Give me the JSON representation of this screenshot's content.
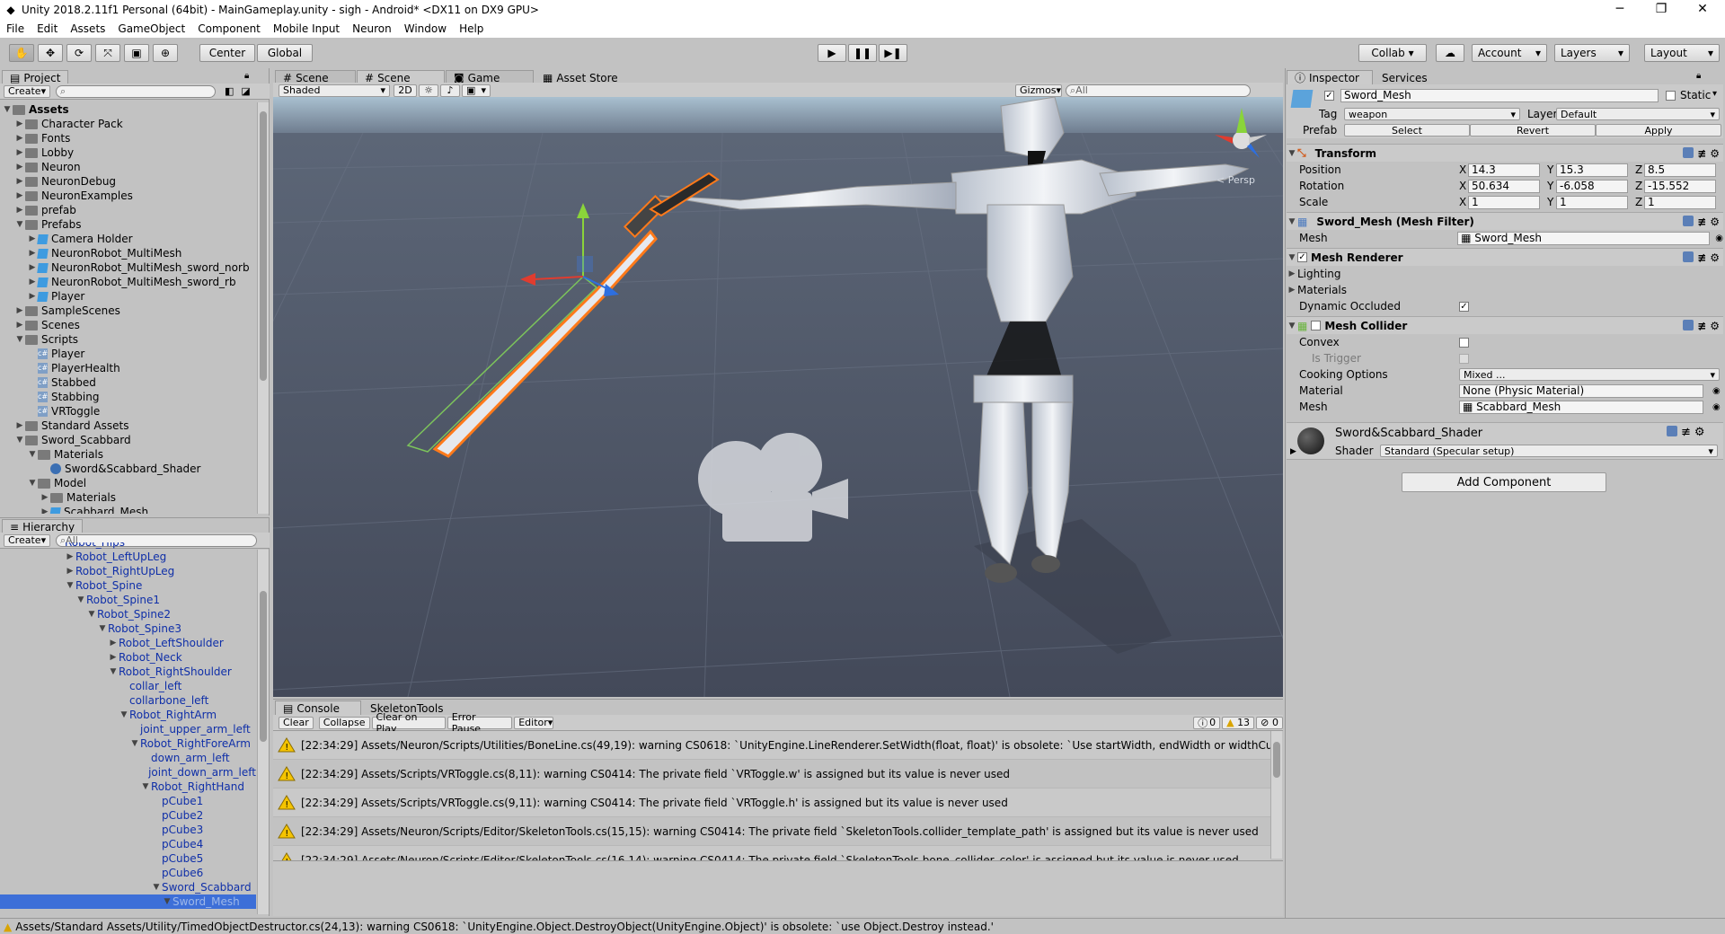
{
  "window": {
    "title": "Unity 2018.2.11f1 Personal (64bit) - MainGameplay.unity - sigh - Android* <DX11 on DX9 GPU>",
    "minimize": "─",
    "maximize": "❐",
    "close": "✕"
  },
  "menu": [
    "File",
    "Edit",
    "Assets",
    "GameObject",
    "Component",
    "Mobile Input",
    "Neuron",
    "Window",
    "Help"
  ],
  "toolbar": {
    "center": "Center",
    "global": "Global",
    "collab": "Collab ▾",
    "account": "Account",
    "layers": "Layers",
    "layout": "Layout"
  },
  "project": {
    "tab": "Project",
    "create": "Create",
    "items": [
      {
        "label": "Assets",
        "depth": 0,
        "open": true,
        "type": "folder",
        "bold": true
      },
      {
        "label": "Character Pack",
        "depth": 1,
        "type": "folder"
      },
      {
        "label": "Fonts",
        "depth": 1,
        "type": "folder"
      },
      {
        "label": "Lobby",
        "depth": 1,
        "type": "folder"
      },
      {
        "label": "Neuron",
        "depth": 1,
        "type": "folder"
      },
      {
        "label": "NeuronDebug",
        "depth": 1,
        "type": "folder"
      },
      {
        "label": "NeuronExamples",
        "depth": 1,
        "type": "folder"
      },
      {
        "label": "prefab",
        "depth": 1,
        "type": "folder"
      },
      {
        "label": "Prefabs",
        "depth": 1,
        "open": true,
        "type": "folder"
      },
      {
        "label": "Camera Holder",
        "depth": 2,
        "type": "prefab"
      },
      {
        "label": "NeuronRobot_MultiMesh",
        "depth": 2,
        "type": "prefab"
      },
      {
        "label": "NeuronRobot_MultiMesh_sword_norb",
        "depth": 2,
        "type": "prefab"
      },
      {
        "label": "NeuronRobot_MultiMesh_sword_rb",
        "depth": 2,
        "type": "prefab"
      },
      {
        "label": "Player",
        "depth": 2,
        "type": "prefab"
      },
      {
        "label": "SampleScenes",
        "depth": 1,
        "type": "folder"
      },
      {
        "label": "Scenes",
        "depth": 1,
        "type": "folder"
      },
      {
        "label": "Scripts",
        "depth": 1,
        "open": true,
        "type": "folder"
      },
      {
        "label": "Player",
        "depth": 2,
        "type": "script"
      },
      {
        "label": "PlayerHealth",
        "depth": 2,
        "type": "script"
      },
      {
        "label": "Stabbed",
        "depth": 2,
        "type": "script"
      },
      {
        "label": "Stabbing",
        "depth": 2,
        "type": "script"
      },
      {
        "label": "VRToggle",
        "depth": 2,
        "type": "script"
      },
      {
        "label": "Standard Assets",
        "depth": 1,
        "type": "folder"
      },
      {
        "label": "Sword_Scabbard",
        "depth": 1,
        "open": true,
        "type": "folder"
      },
      {
        "label": "Materials",
        "depth": 2,
        "open": true,
        "type": "folder"
      },
      {
        "label": "Sword&Scabbard_Shader",
        "depth": 3,
        "type": "material"
      },
      {
        "label": "Model",
        "depth": 2,
        "open": true,
        "type": "folder"
      },
      {
        "label": "Materials",
        "depth": 3,
        "type": "folder"
      },
      {
        "label": "Scabbard_Mesh",
        "depth": 3,
        "type": "prefab"
      }
    ]
  },
  "hierarchy": {
    "tab": "Hierarchy",
    "create": "Create",
    "search": "All",
    "items": [
      {
        "label": "Robot_Hips",
        "depth": 3,
        "arrow": ""
      },
      {
        "label": "Robot_LeftUpLeg",
        "depth": 4,
        "arrow": "▶"
      },
      {
        "label": "Robot_RightUpLeg",
        "depth": 4,
        "arrow": "▶"
      },
      {
        "label": "Robot_Spine",
        "depth": 4,
        "arrow": "▼"
      },
      {
        "label": "Robot_Spine1",
        "depth": 5,
        "arrow": "▼"
      },
      {
        "label": "Robot_Spine2",
        "depth": 6,
        "arrow": "▼"
      },
      {
        "label": "Robot_Spine3",
        "depth": 7,
        "arrow": "▼"
      },
      {
        "label": "Robot_LeftShoulder",
        "depth": 8,
        "arrow": "▶"
      },
      {
        "label": "Robot_Neck",
        "depth": 8,
        "arrow": "▶"
      },
      {
        "label": "Robot_RightShoulder",
        "depth": 8,
        "arrow": "▼"
      },
      {
        "label": "collar_left",
        "depth": 9,
        "arrow": ""
      },
      {
        "label": "collarbone_left",
        "depth": 9,
        "arrow": ""
      },
      {
        "label": "Robot_RightArm",
        "depth": 9,
        "arrow": "▼"
      },
      {
        "label": "joint_upper_arm_left",
        "depth": 10,
        "arrow": ""
      },
      {
        "label": "Robot_RightForeArm",
        "depth": 10,
        "arrow": "▼"
      },
      {
        "label": "down_arm_left",
        "depth": 11,
        "arrow": ""
      },
      {
        "label": "joint_down_arm_left",
        "depth": 11,
        "arrow": ""
      },
      {
        "label": "Robot_RightHand",
        "depth": 11,
        "arrow": "▼"
      },
      {
        "label": "pCube1",
        "depth": 12,
        "arrow": ""
      },
      {
        "label": "pCube2",
        "depth": 12,
        "arrow": ""
      },
      {
        "label": "pCube3",
        "depth": 12,
        "arrow": ""
      },
      {
        "label": "pCube4",
        "depth": 12,
        "arrow": ""
      },
      {
        "label": "pCube5",
        "depth": 12,
        "arrow": ""
      },
      {
        "label": "pCube6",
        "depth": 12,
        "arrow": ""
      },
      {
        "label": "Sword_Scabbard",
        "depth": 12,
        "arrow": "▼"
      },
      {
        "label": "Sword_Mesh",
        "depth": 13,
        "arrow": "▼",
        "selected": true
      }
    ]
  },
  "scene": {
    "tabs": [
      "Scene",
      "Scene",
      "Game",
      "Asset Store"
    ],
    "shaded": "Shaded",
    "mode2d": "2D",
    "gizmos": "Gizmos",
    "search": "All",
    "persp": "< Persp"
  },
  "console": {
    "tabs": [
      "Console",
      "SkeletonTools"
    ],
    "buttons": [
      "Clear",
      "Collapse",
      "Clear on Play",
      "Error Pause",
      "Editor"
    ],
    "counts": {
      "info": "0",
      "warn": "13",
      "error": "0"
    },
    "rows": [
      "[22:34:29] Assets/Neuron/Scripts/Utilities/BoneLine.cs(49,19): warning CS0618: `UnityEngine.LineRenderer.SetWidth(float, float)' is obsolete: `Use startWidth, endWidth or widthCurve ins",
      "[22:34:29] Assets/Scripts/VRToggle.cs(8,11): warning CS0414: The private field `VRToggle.w' is assigned but its value is never used",
      "[22:34:29] Assets/Scripts/VRToggle.cs(9,11): warning CS0414: The private field `VRToggle.h' is assigned but its value is never used",
      "[22:34:29] Assets/Neuron/Scripts/Editor/SkeletonTools.cs(15,15): warning CS0414: The private field `SkeletonTools.collider_template_path' is assigned but its value is never used",
      "[22:34:29] Assets/Neuron/Scripts/Editor/SkeletonTools.cs(16,14): warning CS0414: The private field `SkeletonTools.bone_collider_color' is assigned but its value is never used"
    ]
  },
  "inspector": {
    "tabs": [
      "Inspector",
      "Services"
    ],
    "name": "Sword_Mesh",
    "static": "Static",
    "tag_label": "Tag",
    "tag": "weapon",
    "layer_label": "Layer",
    "layer": "Default",
    "prefab_label": "Prefab",
    "prefab_buttons": [
      "Select",
      "Revert",
      "Apply"
    ],
    "transform": {
      "title": "Transform",
      "position": {
        "label": "Position",
        "x": "14.3",
        "y": "15.3",
        "z": "8.5"
      },
      "rotation": {
        "label": "Rotation",
        "x": "50.634",
        "y": "-6.058",
        "z": "-15.552"
      },
      "scale": {
        "label": "Scale",
        "x": "1",
        "y": "1",
        "z": "1"
      }
    },
    "mesh_filter": {
      "title": "Sword_Mesh (Mesh Filter)",
      "mesh_label": "Mesh",
      "mesh": "Sword_Mesh"
    },
    "mesh_renderer": {
      "title": "Mesh Renderer",
      "lighting": "Lighting",
      "materials": "Materials",
      "dynamic": "Dynamic Occluded"
    },
    "mesh_collider": {
      "title": "Mesh Collider",
      "convex": "Convex",
      "trigger": "Is Trigger",
      "cooking": "Cooking Options",
      "cooking_val": "Mixed ...",
      "material": "Material",
      "material_val": "None (Physic Material)",
      "mesh": "Mesh",
      "mesh_val": "Scabbard_Mesh"
    },
    "shader": {
      "name": "Sword&Scabbard_Shader",
      "label": "Shader",
      "value": "Standard (Specular setup)"
    },
    "add_component": "Add Component"
  },
  "status": "Assets/Standard Assets/Utility/TimedObjectDestructor.cs(24,13): warning CS0618: `UnityEngine.Object.DestroyObject(UnityEngine.Object)' is obsolete: `use Object.Destroy instead.'"
}
